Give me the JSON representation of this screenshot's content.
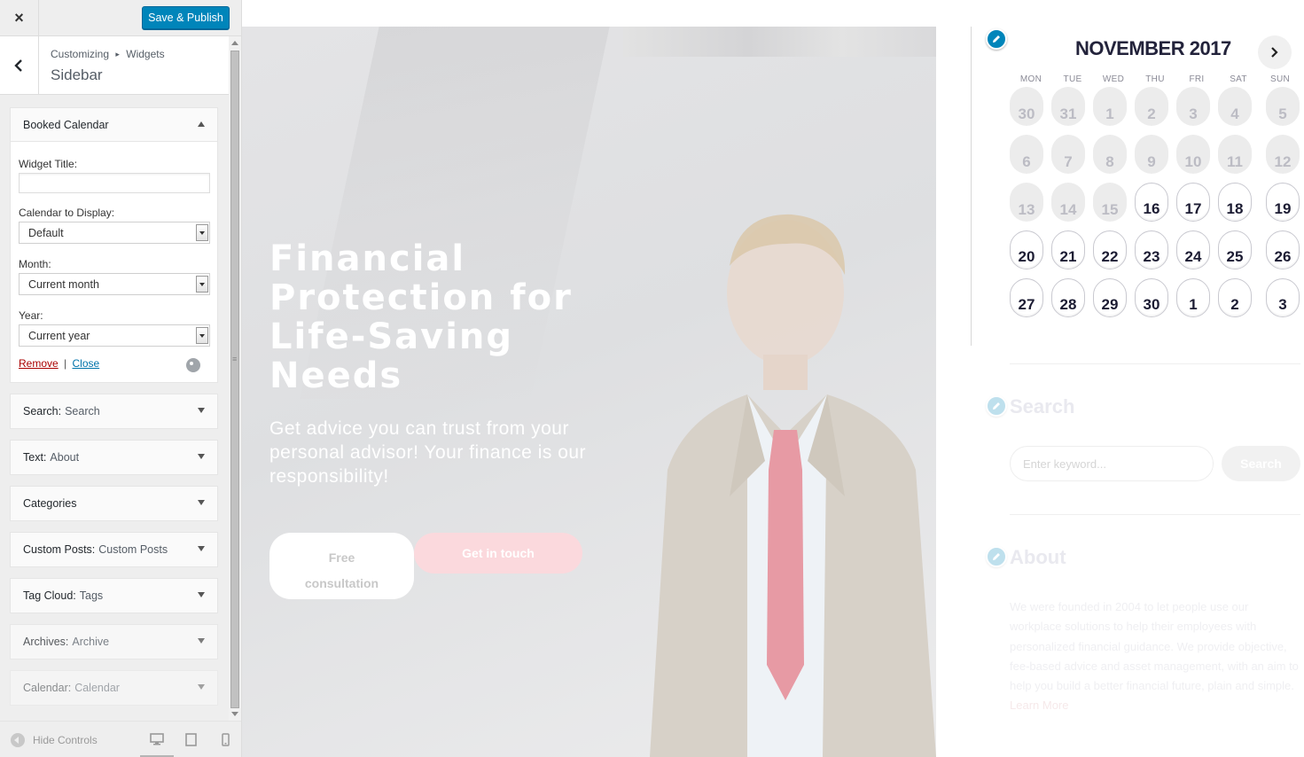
{
  "customizer": {
    "close_icon": "×",
    "save_label": "Save & Publish",
    "back_icon": "‹",
    "crumb_root": "Customizing",
    "crumb_sep": "▸",
    "crumb_child": "Widgets",
    "section_title": "Sidebar",
    "open_widget": {
      "title": "Booked Calendar",
      "widget_title_label": "Widget Title:",
      "widget_title_value": "",
      "calendar_label": "Calendar to Display:",
      "calendar_value": "Default",
      "month_label": "Month:",
      "month_value": "Current month",
      "year_label": "Year:",
      "year_value": "Current year",
      "remove_label": "Remove",
      "separator": "|",
      "close_label": "Close"
    },
    "widgets": [
      {
        "name": "Search:",
        "sub": "Search"
      },
      {
        "name": "Text:",
        "sub": "About"
      },
      {
        "name": "Categories",
        "sub": ""
      },
      {
        "name": "Custom Posts:",
        "sub": "Custom Posts"
      },
      {
        "name": "Tag Cloud:",
        "sub": "Tags"
      },
      {
        "name": "Archives:",
        "sub": "Archive"
      },
      {
        "name": "Calendar:",
        "sub": "Calendar"
      }
    ],
    "footer": {
      "hide_controls": "Hide Controls",
      "devices": [
        "desktop-icon",
        "tablet-icon",
        "mobile-icon"
      ]
    }
  },
  "preview": {
    "hero": {
      "title_lines": [
        "Financial",
        "Protection for",
        "Life-Saving",
        "Needs"
      ],
      "subtitle": "Get advice you can trust from your personal advisor! Your finance is our responsibility!",
      "btn_free_line1": "Free",
      "btn_free_line2": "consultation",
      "btn_touch": "Get in touch"
    },
    "calendar": {
      "month_title": "NOVEMBER 2017",
      "next_icon": "›",
      "weekdays": [
        "MON",
        "TUE",
        "WED",
        "THU",
        "FRI",
        "SAT",
        "SUN"
      ],
      "weeks": [
        [
          {
            "d": "30",
            "a": false
          },
          {
            "d": "31",
            "a": false
          },
          {
            "d": "1",
            "a": false
          },
          {
            "d": "2",
            "a": false
          },
          {
            "d": "3",
            "a": false
          },
          {
            "d": "4",
            "a": false
          },
          {
            "d": "5",
            "a": false
          }
        ],
        [
          {
            "d": "6",
            "a": false
          },
          {
            "d": "7",
            "a": false
          },
          {
            "d": "8",
            "a": false
          },
          {
            "d": "9",
            "a": false
          },
          {
            "d": "10",
            "a": false
          },
          {
            "d": "11",
            "a": false
          },
          {
            "d": "12",
            "a": false
          }
        ],
        [
          {
            "d": "13",
            "a": false
          },
          {
            "d": "14",
            "a": false
          },
          {
            "d": "15",
            "a": false
          },
          {
            "d": "16",
            "a": true
          },
          {
            "d": "17",
            "a": true
          },
          {
            "d": "18",
            "a": true
          },
          {
            "d": "19",
            "a": true
          }
        ],
        [
          {
            "d": "20",
            "a": true
          },
          {
            "d": "21",
            "a": true
          },
          {
            "d": "22",
            "a": true
          },
          {
            "d": "23",
            "a": true
          },
          {
            "d": "24",
            "a": true
          },
          {
            "d": "25",
            "a": true
          },
          {
            "d": "26",
            "a": true
          }
        ],
        [
          {
            "d": "27",
            "a": true
          },
          {
            "d": "28",
            "a": true
          },
          {
            "d": "29",
            "a": true
          },
          {
            "d": "30",
            "a": true
          },
          {
            "d": "1",
            "a": true
          },
          {
            "d": "2",
            "a": true
          },
          {
            "d": "3",
            "a": true
          }
        ]
      ]
    },
    "search_widget": {
      "title": "Search",
      "placeholder": "Enter keyword...",
      "button": "Search"
    },
    "about_widget": {
      "title": "About",
      "text": "We were founded in 2004 to let people use our workplace solutions to help their employees with personalized financial guidance. We provide objective, fee-based advice and asset management, with an aim to help you build a better financial future, plain and simple.",
      "more": "Learn More"
    },
    "colors": {
      "accent": "#0085ba",
      "calendar_text": "#23233b",
      "touch_button": "#fbd9dd"
    }
  }
}
